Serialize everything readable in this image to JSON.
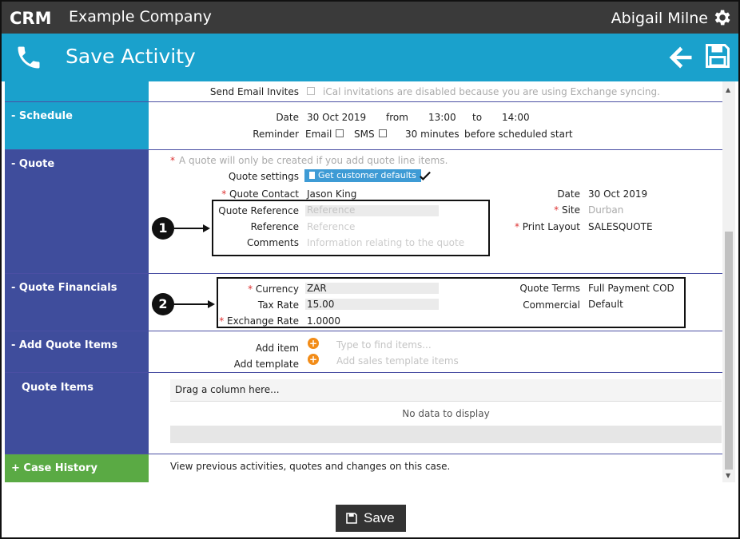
{
  "app": {
    "logo": "CRM",
    "company": "Example Company",
    "user": "Abigail Milne"
  },
  "header": {
    "title": "Save Activity"
  },
  "invites": {
    "label": "Send Email Invites",
    "note": "iCal invitations are disabled because you are using Exchange syncing."
  },
  "schedule": {
    "section": "- Schedule",
    "date_label": "Date",
    "date": "30 Oct 2019",
    "from_label": "from",
    "from": "13:00",
    "to_label": "to",
    "to": "14:00",
    "reminder_label": "Reminder",
    "email_label": "Email",
    "sms_label": "SMS",
    "minutes": "30 minutes",
    "before": "before scheduled start"
  },
  "quote": {
    "section": "- Quote",
    "note": "A quote will only be created if you add quote line items.",
    "settings_label": "Quote settings",
    "defaults_button": "Get customer defaults",
    "contact_label": "Quote Contact",
    "contact": "Jason King",
    "reference_label": "Quote Reference",
    "reference_placeholder": "Reference",
    "ref_label": "Reference",
    "ref_placeholder": "Reference",
    "comments_label": "Comments",
    "comments_placeholder": "Information relating to the quote",
    "date_label": "Date",
    "date": "30 Oct 2019",
    "site_label": "Site",
    "site": "Durban",
    "print_label": "Print Layout",
    "print": "SALESQUOTE"
  },
  "financials": {
    "section": "- Quote Financials",
    "currency_label": "Currency",
    "currency": "ZAR",
    "tax_label": "Tax Rate",
    "tax": "15.00",
    "exchange_label": "Exchange Rate",
    "exchange": "1.0000",
    "terms_label": "Quote Terms",
    "terms": "Full Payment COD",
    "commercial_label": "Commercial",
    "commercial": "Default"
  },
  "add_items": {
    "section": "- Add Quote Items",
    "add_item_label": "Add item",
    "add_item_placeholder": "Type to find items...",
    "add_template_label": "Add template",
    "add_template_placeholder": "Add sales template items"
  },
  "quote_items": {
    "section": "Quote Items",
    "grid_header": "Drag a column here...",
    "empty": "No data to display"
  },
  "case_history": {
    "section": "+ Case History",
    "text": "View previous activities, quotes and changes on this case."
  },
  "callouts": [
    "1",
    "2"
  ],
  "footer": {
    "save_label": "Save"
  },
  "required_mark": "*",
  "colors": {
    "topbar": "#3a3a3a",
    "accent": "#1aa1cc",
    "navy": "#3f4d9c",
    "green": "#5aaa44",
    "orange": "#f28c18"
  }
}
